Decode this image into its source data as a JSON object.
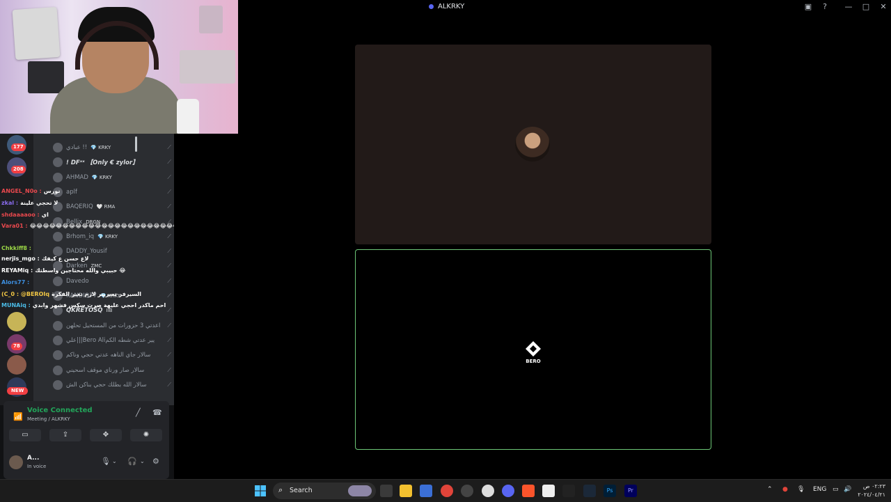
{
  "window": {
    "title": "ALKRKY",
    "controls": [
      "▣",
      "?",
      "—",
      "□",
      "✕"
    ]
  },
  "servers": [
    {
      "badge": "177"
    },
    {
      "badge": "208"
    },
    {
      "badge": ""
    },
    {
      "badge": "78"
    },
    {
      "badge": ""
    },
    {
      "badge": "NEW"
    }
  ],
  "members": [
    {
      "name": "عبادي !!",
      "tag": "💎 KRKY"
    },
    {
      "name": "! DFˣˣ 【Only € zylor】",
      "tag": "",
      "active": true
    },
    {
      "name": "AHMAD",
      "tag": "💎 KRKY"
    },
    {
      "name": "aplf",
      "tag": ""
    },
    {
      "name": "BAQERIQ",
      "tag": "🤍 RMA"
    },
    {
      "name": "Bellix",
      "tag": "DRGN"
    },
    {
      "name": "Brhom_iq",
      "tag": "💎 KRKY"
    },
    {
      "name": "DADDY_Yousif",
      "tag": ""
    },
    {
      "name": "Darken",
      "tag": "ZMC"
    },
    {
      "name": "Davedo",
      "tag": ""
    },
    {
      "name": "KANDIQ77",
      "tag": "💎 KRKY"
    },
    {
      "name": "QKRETOSQ",
      "tag": "IIB",
      "active": true
    },
    {
      "name": "اعدتي 3 حزورات من المستحيل تحلهن",
      "tag": ""
    },
    {
      "name": "علي|||Bero Aliيير عدتي شطه الكم",
      "tag": ""
    },
    {
      "name": "سالار جاي الناهه عدتي حجي وناكم",
      "tag": ""
    },
    {
      "name": "سالار صار ورناي موقف اسحيني",
      "tag": ""
    },
    {
      "name": "سالار الله بطلك حجي بناكن الش",
      "tag": ""
    }
  ],
  "chat": [
    {
      "user": "ANGEL_N0o :",
      "text": "نورس",
      "color": "#e8484d"
    },
    {
      "user": "zkal :",
      "text": "لا تحجي علينة",
      "color": "#8a6cf0"
    },
    {
      "user": "shdaaaaoo :",
      "text": "اي",
      "color": "#e8484d"
    },
    {
      "user": "Vara01 :",
      "text": "😂😂😂😂😂😂😂😂😂😂😂😂😂😂😂😂😂😂😂😂😂😂😂😂😂",
      "color": "#e8484d"
    },
    {
      "user": "Chkkiff8 :",
      "text": "",
      "color": "#9bd646"
    },
    {
      "user": "nerjis_mgo :",
      "text": "لاع حسن ع كيفك",
      "color": "#ffffff"
    },
    {
      "user": "REYAMiq :",
      "text": "حبيبي والله محتاجين واسطتك 😂",
      "color": "#ffffff"
    },
    {
      "user": "Alors77 :",
      "text": "",
      "color": "#3d8fe0"
    },
    {
      "user": "(C_0 : @BEROIq",
      "text": "السيرفر تسربير لازم تغير الفكرة",
      "color": "#f2c744"
    },
    {
      "user": "MUNAiq :",
      "text": "احم ماكدر احجي عليهة صرت سكس فشهر وابدي",
      "color": "#4bbbe6"
    }
  ],
  "voice": {
    "status": "Voice Connected",
    "channel": "Meeting / ALKRKY",
    "user_name": "A...",
    "user_status": "In voice"
  },
  "stage": {
    "participant2_name": "BERO",
    "tile2_border_color": "#6ec878"
  },
  "taskbar": {
    "search_label": "Search",
    "lang": "ENG",
    "time": "٠٢:٢٣ ص",
    "date": "٢٠٢٤/٠٤/٢١"
  }
}
